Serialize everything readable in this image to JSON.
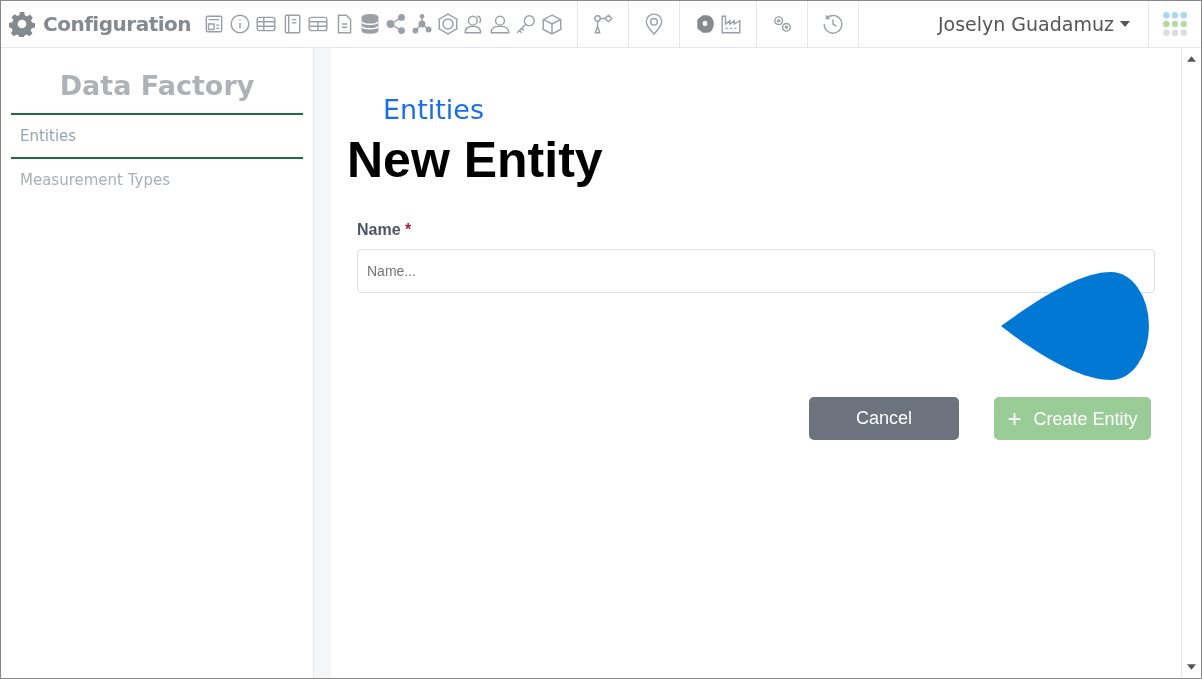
{
  "header": {
    "title": "Configuration",
    "user": "Joselyn Guadamuz"
  },
  "sidebar": {
    "title": "Data Factory",
    "items": [
      {
        "label": "Entities",
        "selected": true
      },
      {
        "label": "Measurement Types",
        "selected": false
      }
    ]
  },
  "breadcrumb": "Entities",
  "page_title": "New Entity",
  "form": {
    "label": "Name",
    "required_mark": "*",
    "placeholder": "Name..."
  },
  "buttons": [
    {
      "kind": "cancel",
      "label": "Cancel",
      "disabled": false
    },
    {
      "kind": "create",
      "icon": "+",
      "label": "Create Entity",
      "disabled": true
    }
  ]
}
